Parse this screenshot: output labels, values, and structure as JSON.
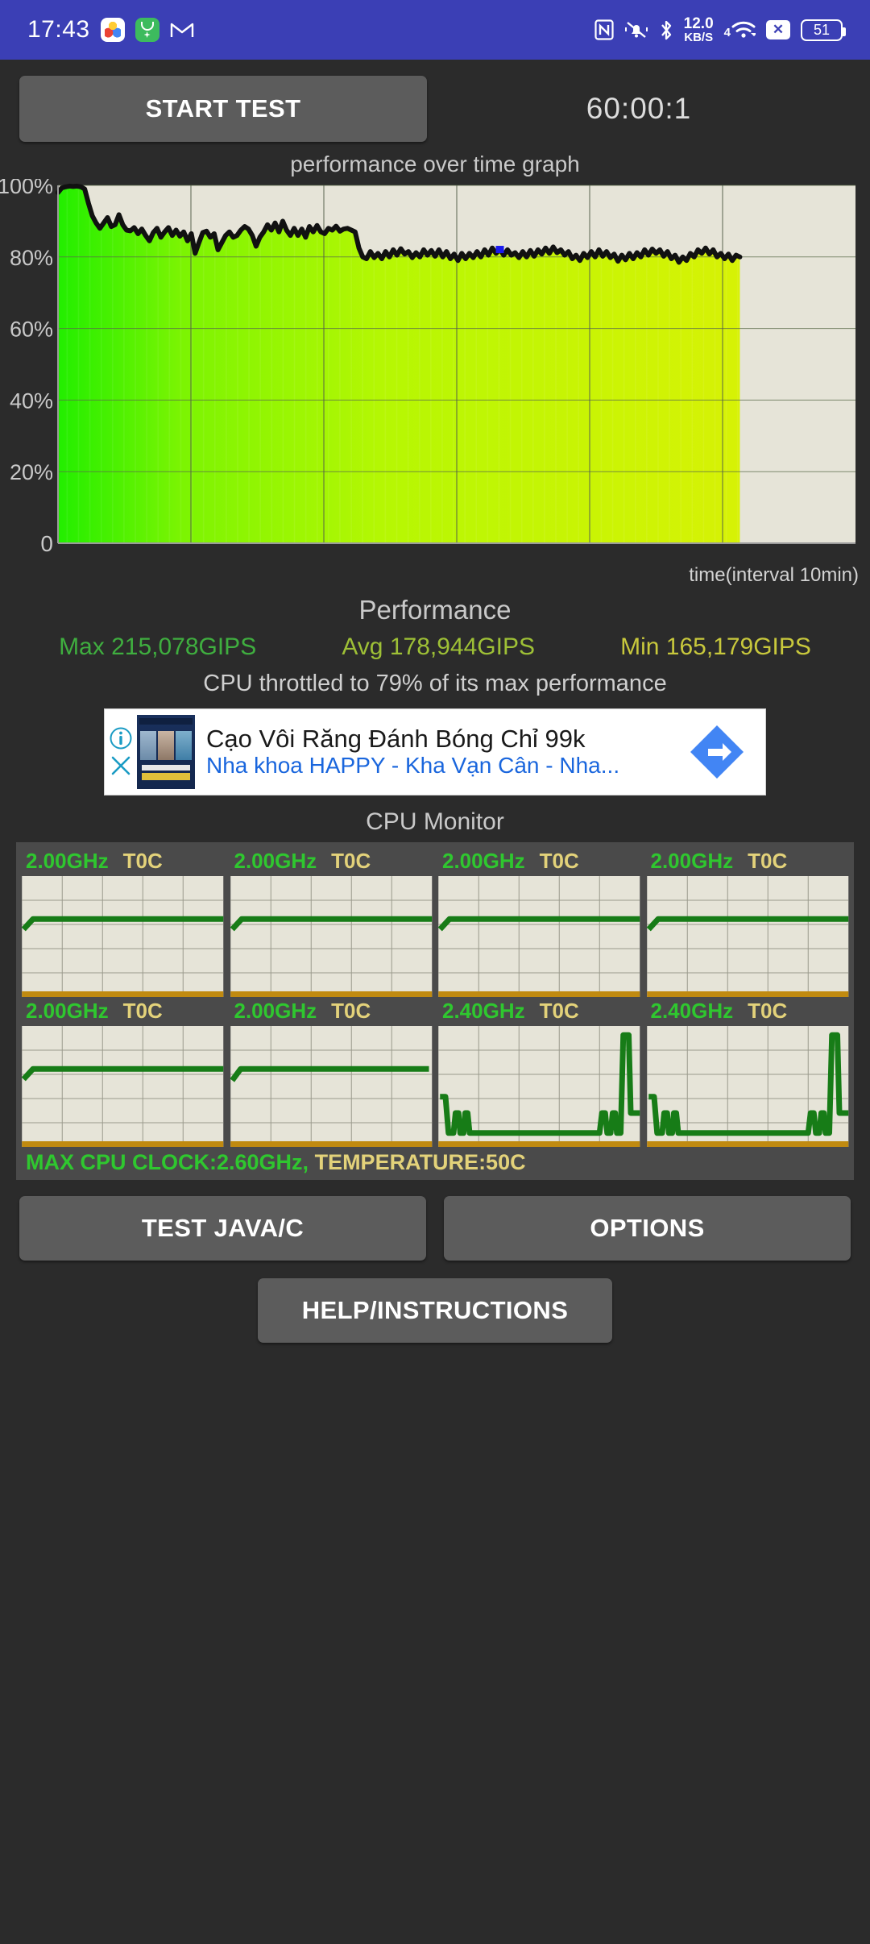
{
  "statusbar": {
    "time": "17:43",
    "icons_left": [
      "photos-app-icon",
      "green-app-icon",
      "gmail-icon"
    ],
    "icons_right": [
      "nfc-icon",
      "mute-vibrate-icon",
      "bluetooth-icon",
      "network-speed",
      "wifi-icon",
      "sim-disabled-icon",
      "battery-icon"
    ],
    "net_speed_value": "12.0",
    "net_speed_unit": "KB/S",
    "wifi_gen": "4",
    "sim_x": "✕",
    "battery_level": "51",
    "bg_color": "#3b3fb5"
  },
  "controls": {
    "start_label": "START TEST",
    "timer": "60:00:1"
  },
  "graph": {
    "title": "performance over time graph",
    "xaxis_label": "time(interval 10min)"
  },
  "chart_data": {
    "type": "line",
    "title": "performance over time graph",
    "xlabel": "time(interval 10min)",
    "ylabel": "",
    "ylim": [
      0,
      100
    ],
    "ytick_labels": [
      "100%",
      "80%",
      "60%",
      "40%",
      "20%",
      "0"
    ],
    "ytick_values": [
      100,
      80,
      60,
      40,
      20,
      0
    ],
    "grid": true,
    "x_gridlines": 6,
    "x_interval_minutes": 10,
    "data_end_fraction": 0.855,
    "plot_bg": "#e6e4d8",
    "line_color": "#111111",
    "marker_color": "#1a1aee",
    "fill_gradient": [
      "#22ee00",
      "#d7f205"
    ],
    "series": [
      {
        "name": "performance %",
        "values": [
          98.0,
          99.3,
          99.6,
          99.8,
          99.7,
          99.8,
          99.6,
          99.0,
          95.0,
          91.5,
          89.5,
          88.0,
          89.5,
          91.0,
          88.5,
          89.0,
          91.8,
          89.0,
          87.5,
          87.3,
          88.2,
          86.5,
          87.8,
          86.0,
          84.5,
          86.8,
          88.0,
          85.5,
          87.0,
          88.2,
          86.0,
          87.5,
          85.8,
          87.0,
          84.5,
          86.5,
          81.0,
          84.0,
          86.8,
          87.2,
          85.5,
          86.5,
          82.0,
          84.0,
          86.0,
          87.0,
          85.5,
          86.0,
          87.5,
          88.5,
          87.8,
          86.0,
          83.0,
          85.5,
          87.0,
          89.0,
          87.5,
          89.5,
          87.0,
          90.0,
          87.5,
          86.0,
          88.0,
          86.0,
          87.8,
          85.5,
          88.5,
          87.0,
          88.8,
          87.0,
          86.5,
          88.0,
          87.5,
          88.6,
          87.2,
          87.8,
          88.0,
          87.5,
          87.0,
          82.5,
          80.0,
          79.5,
          81.5,
          79.8,
          81.0,
          79.5,
          81.5,
          80.0,
          82.0,
          80.5,
          82.3,
          80.8,
          81.5,
          79.8,
          81.2,
          80.0,
          82.0,
          80.5,
          81.8,
          80.2,
          82.0,
          80.0,
          81.5,
          79.5,
          80.8,
          79.0,
          81.0,
          79.5,
          81.0,
          79.8,
          81.5,
          80.0,
          82.0,
          80.5,
          82.5,
          81.0,
          82.2,
          80.5,
          82.0,
          80.5,
          81.2,
          79.8,
          81.5,
          80.0,
          81.8,
          80.2,
          82.0,
          80.8,
          82.5,
          81.0,
          82.8,
          81.2,
          82.0,
          80.5,
          81.5,
          79.5,
          80.5,
          79.0,
          81.0,
          79.8,
          81.5,
          80.0,
          82.0,
          80.2,
          81.5,
          79.8,
          80.8,
          78.8,
          80.5,
          79.2,
          81.0,
          79.5,
          81.2,
          80.0,
          82.0,
          80.5,
          82.2,
          81.0,
          82.0,
          80.2,
          81.5,
          79.5,
          80.5,
          78.5,
          80.0,
          79.0,
          81.0,
          80.0,
          82.0,
          81.0,
          82.5,
          80.8,
          82.0,
          80.0,
          81.0,
          79.5,
          80.8,
          79.0,
          80.5,
          80.0
        ]
      }
    ]
  },
  "performance": {
    "title": "Performance",
    "max_label": "Max 215,078GIPS",
    "avg_label": "Avg 178,944GIPS",
    "min_label": "Min 165,179GIPS",
    "max_value": 215078,
    "avg_value": 178944,
    "min_value": 165179,
    "unit": "GIPS",
    "throttle_text": "CPU throttled to 79% of its max performance",
    "throttle_percent": 79,
    "max_color": "#3fae3f",
    "avg_color": "#9ec036",
    "min_color": "#c8c83c"
  },
  "ad": {
    "headline": "Cạo Vôi Răng Đánh Bóng Chỉ 99k",
    "subline": "Nha khoa HAPPY - Kha Vạn Cân - Nha...",
    "info_icon": "info-icon",
    "close_icon": "close-icon",
    "cta_icon": "arrow-forward-icon",
    "thumb_caption": "CÔNG THỨC KIẾN TẠO NỤ CƯỜI"
  },
  "cpu_monitor": {
    "title": "CPU Monitor",
    "cores": [
      {
        "ghz": "2.00GHz",
        "temp": "T0C",
        "shape": "flat-high"
      },
      {
        "ghz": "2.00GHz",
        "temp": "T0C",
        "shape": "flat-high"
      },
      {
        "ghz": "2.00GHz",
        "temp": "T0C",
        "shape": "flat-high"
      },
      {
        "ghz": "2.00GHz",
        "temp": "T0C",
        "shape": "flat-high"
      },
      {
        "ghz": "2.00GHz",
        "temp": "T0C",
        "shape": "flat-high"
      },
      {
        "ghz": "2.00GHz",
        "temp": "T0C",
        "shape": "flat-high-short"
      },
      {
        "ghz": "2.40GHz",
        "temp": "T0C",
        "shape": "spiky"
      },
      {
        "ghz": "2.40GHz",
        "temp": "T0C",
        "shape": "spiky"
      }
    ],
    "summary_clock": "MAX CPU CLOCK:2.60GHz,",
    "summary_temp": "TEMPERATURE:50C",
    "max_clock_value": "2.60GHz",
    "temperature_value": "50C"
  },
  "buttons": {
    "test_java_c": "TEST JAVA/C",
    "options": "OPTIONS",
    "help": "HELP/INSTRUCTIONS"
  }
}
